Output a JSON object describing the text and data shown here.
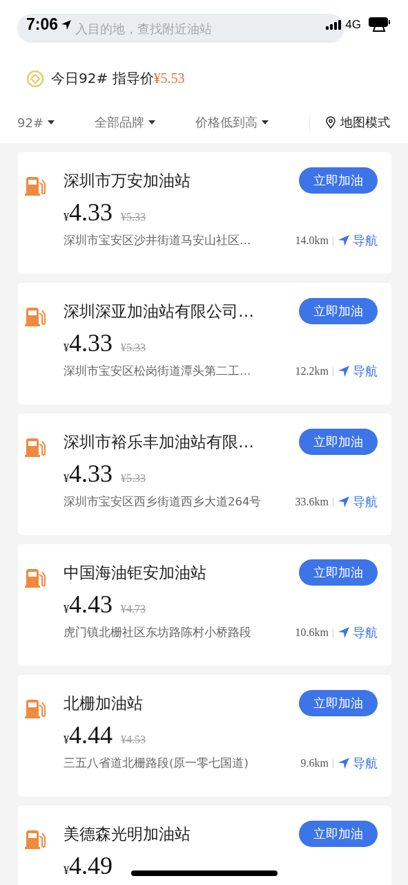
{
  "status_bar": {
    "time": "7:06",
    "network": "4G"
  },
  "search": {
    "placeholder": "入目的地，查找附近油站"
  },
  "guide_price": {
    "label": "今日92# 指导价",
    "price": "¥5.53"
  },
  "filters": [
    {
      "label": "92#",
      "kind": "dropdown"
    },
    {
      "label": "全部品牌",
      "kind": "dropdown"
    },
    {
      "label": "价格低到高",
      "kind": "dropdown"
    },
    {
      "label": "地图模式",
      "kind": "map"
    }
  ],
  "stations": [
    {
      "name": "深圳市万安加油站",
      "price": "4.33",
      "currency": "¥",
      "old_price": "¥5.33",
      "address": "深圳市宝安区沙井街道马安山社区…",
      "distance": "14.0km",
      "nav": "导航",
      "button": "立即加油"
    },
    {
      "name": "深圳深亚加油站有限公司…",
      "price": "4.33",
      "currency": "¥",
      "old_price": "¥5.33",
      "address": "深圳市宝安区松岗街道潭头第二工…",
      "distance": "12.2km",
      "nav": "导航",
      "button": "立即加油"
    },
    {
      "name": "深圳市裕乐丰加油站有限…",
      "price": "4.33",
      "currency": "¥",
      "old_price": "¥5.33",
      "address": "深圳市宝安区西乡街道西乡大道264号",
      "distance": "33.6km",
      "nav": "导航",
      "button": "立即加油"
    },
    {
      "name": "中国海油钜安加油站",
      "price": "4.43",
      "currency": "¥",
      "old_price": "¥4.73",
      "address": "虎门镇北栅社区东坊路陈村小桥路段",
      "distance": "10.6km",
      "nav": "导航",
      "button": "立即加油"
    },
    {
      "name": "北栅加油站",
      "price": "4.44",
      "currency": "¥",
      "old_price": "¥4.53",
      "address": "三五八省道北栅路段(原一零七国道)",
      "distance": "9.6km",
      "nav": "导航",
      "button": "立即加油"
    },
    {
      "name": "美德森光明加油站",
      "price": "4.49",
      "currency": "¥",
      "button": "立即加油"
    }
  ]
}
